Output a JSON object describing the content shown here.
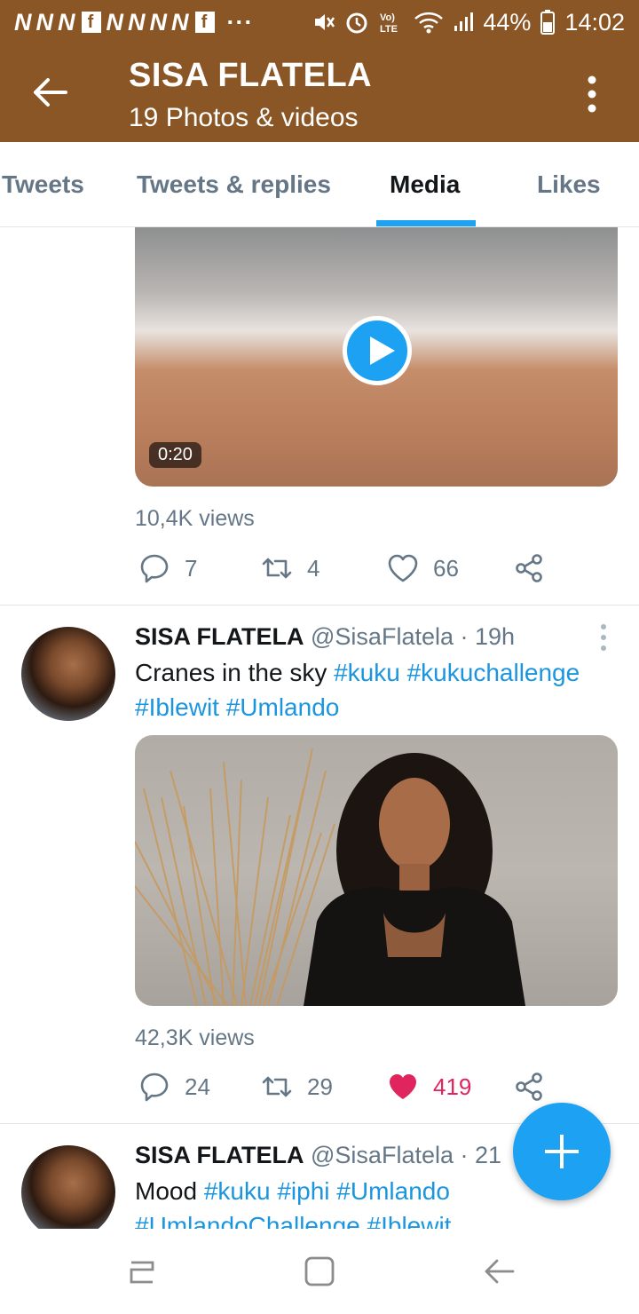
{
  "status_bar": {
    "notification_icons": [
      "N",
      "N",
      "N",
      "f",
      "N",
      "N",
      "N",
      "N",
      "f"
    ],
    "dots": "···",
    "battery": "44%",
    "time": "14:02"
  },
  "app_bar": {
    "title": "SISA FLATELA",
    "subtitle": "19 Photos & videos"
  },
  "tabs": [
    {
      "label": "Tweets",
      "active": false
    },
    {
      "label": "Tweets & replies",
      "active": false
    },
    {
      "label": "Media",
      "active": true
    },
    {
      "label": "Likes",
      "active": false
    }
  ],
  "tweets": [
    {
      "video_duration": "0:20",
      "views": "10,4K views",
      "replies": "7",
      "retweets": "4",
      "likes": "66",
      "liked": false
    },
    {
      "name": "SISA FLATELA",
      "handle": "@SisaFlatela",
      "time": " · 19h",
      "text_plain": "Cranes in the sky ",
      "hashtags": [
        "#kuku",
        "#kukuchallenge",
        "#Iblewit",
        "#Umlando"
      ],
      "views": "42,3K views",
      "replies": "24",
      "retweets": "29",
      "likes": "419",
      "liked": true
    },
    {
      "name": "SISA FLATELA",
      "handle": "@SisaFlatela",
      "time": " · 21",
      "text_plain": "Mood ",
      "hashtags": [
        "#kuku",
        "#iphi",
        "#Umlando",
        "#UmlandoChallenge",
        "#Iblewit"
      ]
    }
  ],
  "colors": {
    "header": "#8b5625",
    "accent": "#1da1f2",
    "like": "#e0245e"
  }
}
